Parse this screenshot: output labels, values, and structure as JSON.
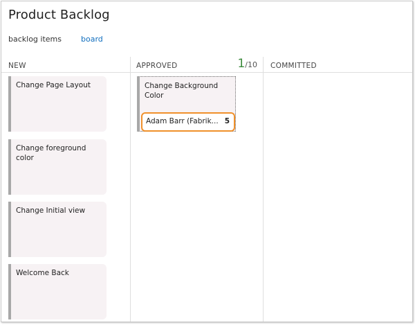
{
  "page": {
    "title": "Product Backlog"
  },
  "view_tabs": {
    "backlog": "backlog items",
    "board": "board"
  },
  "columns": [
    {
      "name": "NEW"
    },
    {
      "name": "APPROVED",
      "wip_current": "1",
      "wip_max": "/10"
    },
    {
      "name": "COMMITTED"
    }
  ],
  "cards": {
    "new": [
      "Change Page Layout",
      "Change foreground color",
      "Change Initial view",
      "Welcome Back"
    ],
    "approved": [
      {
        "title": "Change Background Color",
        "assigned_to": "Adam Barr (Fabrik...",
        "effort": "5"
      }
    ]
  },
  "colors": {
    "card_background": "#f7f2f4",
    "card_left_bar": "#a8a8a8",
    "highlight": "#f0902a",
    "link": "#106ebe",
    "wip": "#3b8a3b"
  }
}
